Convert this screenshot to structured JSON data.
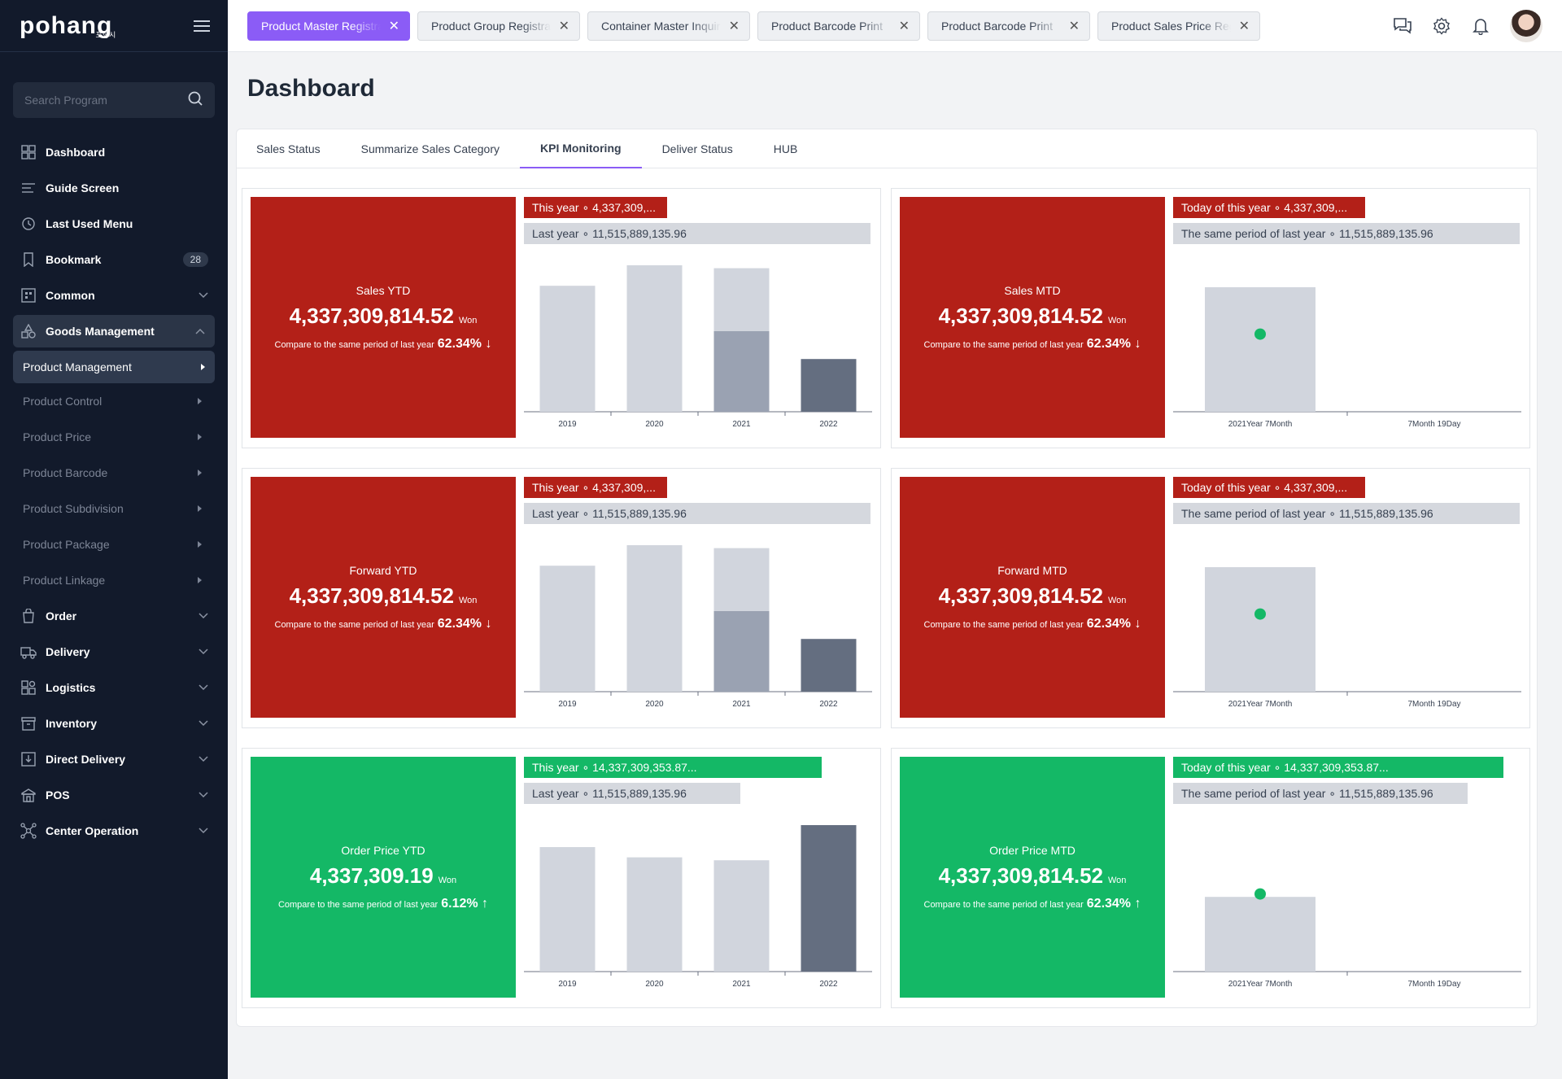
{
  "app": {
    "logo": "pohang",
    "logo_sub": "포항시"
  },
  "search": {
    "placeholder": "Search Program"
  },
  "sidebar": {
    "items": [
      {
        "label": "Dashboard",
        "icon": "grid-icon"
      },
      {
        "label": "Guide Screen",
        "icon": "guide-icon"
      },
      {
        "label": "Last Used Menu",
        "icon": "history-icon"
      },
      {
        "label": "Bookmark",
        "icon": "bookmark-icon",
        "badge": "28"
      },
      {
        "label": "Common",
        "icon": "common-icon"
      },
      {
        "label": "Goods Management",
        "icon": "goods-icon"
      },
      {
        "label": "Order",
        "icon": "order-icon"
      },
      {
        "label": "Delivery",
        "icon": "truck-icon"
      },
      {
        "label": "Logistics",
        "icon": "logistics-icon"
      },
      {
        "label": "Inventory",
        "icon": "inventory-icon"
      },
      {
        "label": "Direct Delivery",
        "icon": "direct-delivery-icon"
      },
      {
        "label": "POS",
        "icon": "pos-icon"
      },
      {
        "label": "Center Operation",
        "icon": "network-icon"
      }
    ],
    "sub_items": [
      "Product Management",
      "Product Control",
      "Product Price",
      "Product Barcode",
      "Product Subdivision",
      "Product Package",
      "Product Linkage"
    ]
  },
  "tabs": [
    "Product Master Registration",
    "Product Group Registration",
    "Container Master Inquiry",
    "Product Barcode Print",
    "Product Barcode Print",
    "Product Sales Price Registration"
  ],
  "page": {
    "title": "Dashboard"
  },
  "content_tabs": [
    "Sales Status",
    "Summarize Sales Category",
    "KPI Monitoring",
    "Deliver Status",
    "HUB"
  ],
  "colors": {
    "accent": "#8b5cf6",
    "down": "#b32018",
    "up": "#14b866",
    "bar_light": "#d1d5dd",
    "bar_mid": "#9aa2b2",
    "bar_dark": "#646e80",
    "dot": "#14b866"
  },
  "cards": [
    {
      "title": "Sales YTD",
      "value": "4,337,309,814.52",
      "unit": "Won",
      "compare": "Compare to the same period of last year",
      "pct": "62.34%",
      "arrow": "↓",
      "color": "red",
      "legend1": "This year ∘ 4,337,309,...",
      "legend2": "Last year ∘ 11,515,889,135.96"
    },
    {
      "title": "Sales MTD",
      "value": "4,337,309,814.52",
      "unit": "Won",
      "compare": "Compare to the same period of last year",
      "pct": "62.34%",
      "arrow": "↓",
      "color": "red",
      "legend1": "Today of this year ∘ 4,337,309,...",
      "legend2": "The same period of last year ∘ 11,515,889,135.96"
    },
    {
      "title": "Forward YTD",
      "value": "4,337,309,814.52",
      "unit": "Won",
      "compare": "Compare to the same period of last year",
      "pct": "62.34%",
      "arrow": "↓",
      "color": "red",
      "legend1": "This year ∘ 4,337,309,...",
      "legend2": "Last year ∘ 11,515,889,135.96"
    },
    {
      "title": "Forward MTD",
      "value": "4,337,309,814.52",
      "unit": "Won",
      "compare": "Compare to the same period of last year",
      "pct": "62.34%",
      "arrow": "↓",
      "color": "red",
      "legend1": "Today of this year ∘ 4,337,309,...",
      "legend2": "The same period of last year ∘ 11,515,889,135.96"
    },
    {
      "title": "Order Price YTD",
      "value": "4,337,309.19",
      "unit": "Won",
      "compare": "Compare to the same period of last year",
      "pct": "6.12%",
      "arrow": "↑",
      "color": "green",
      "legend1": "This year ∘ 14,337,309,353.87...",
      "legend2": "Last year ∘ 11,515,889,135.96"
    },
    {
      "title": "Order Price MTD",
      "value": "4,337,309,814.52",
      "unit": "Won",
      "compare": "Compare to the same period of last year",
      "pct": "62.34%",
      "arrow": "↑",
      "color": "green",
      "legend1": "Today of this year ∘ 14,337,309,353.87...",
      "legend2": "The same period of last year ∘ 11,515,889,135.96"
    }
  ],
  "chart_data": [
    {
      "type": "bar",
      "categories": [
        "2019",
        "2020",
        "2021",
        "2022"
      ],
      "series": [
        {
          "name": "Last year",
          "values": [
            0.86,
            1.0,
            0.98,
            0
          ]
        },
        {
          "name": "This year",
          "values": [
            0,
            0,
            0.55,
            0.36
          ]
        }
      ]
    },
    {
      "type": "scatter",
      "categories": [
        "2021Year 7Month",
        "7Month 19Day"
      ],
      "series": [
        {
          "name": "The same period of last year",
          "values": [
            0.85,
            null
          ]
        },
        {
          "name": "Today of this year",
          "values": [
            0.53,
            null
          ]
        }
      ]
    },
    {
      "type": "bar",
      "categories": [
        "2019",
        "2020",
        "2021",
        "2022"
      ],
      "series": [
        {
          "name": "Last year",
          "values": [
            0.86,
            1.0,
            0.98,
            0
          ]
        },
        {
          "name": "This year",
          "values": [
            0,
            0,
            0.55,
            0.36
          ]
        }
      ]
    },
    {
      "type": "scatter",
      "categories": [
        "2021Year 7Month",
        "7Month 19Day"
      ],
      "series": [
        {
          "name": "The same period of last year",
          "values": [
            0.85,
            null
          ]
        },
        {
          "name": "Today of this year",
          "values": [
            0.53,
            null
          ]
        }
      ]
    },
    {
      "type": "bar",
      "categories": [
        "2019",
        "2020",
        "2021",
        "2022"
      ],
      "series": [
        {
          "name": "Last year",
          "values": [
            0.85,
            0.78,
            0.76,
            0
          ]
        },
        {
          "name": "This year",
          "values": [
            0,
            0,
            0,
            1.0
          ]
        }
      ]
    },
    {
      "type": "scatter",
      "categories": [
        "2021Year 7Month",
        "7Month 19Day"
      ],
      "series": [
        {
          "name": "The same period of last year",
          "values": [
            0.51,
            null
          ]
        },
        {
          "name": "Today of this year",
          "values": [
            0.53,
            null
          ]
        }
      ]
    }
  ]
}
